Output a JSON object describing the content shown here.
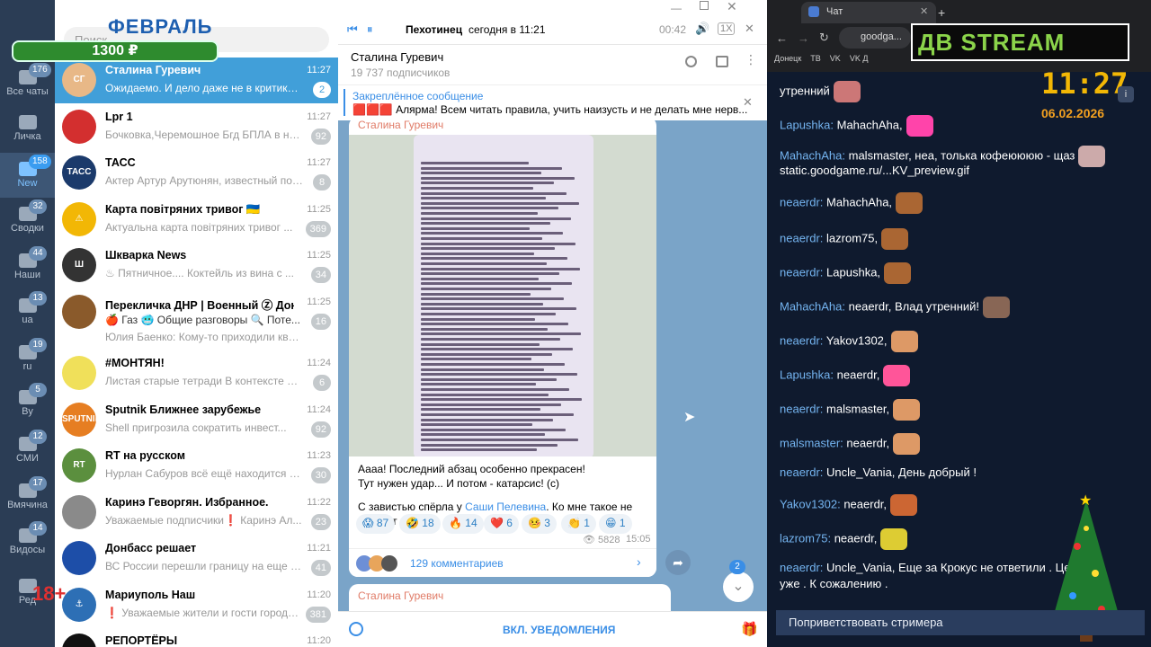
{
  "rail": {
    "items": [
      {
        "label": "Все чаты",
        "count": "176"
      },
      {
        "label": "Личка",
        "count": ""
      },
      {
        "label": "New",
        "count": "158"
      },
      {
        "label": "Сводки",
        "count": "32"
      },
      {
        "label": "Наши",
        "count": "44"
      },
      {
        "label": "ua",
        "count": "13"
      },
      {
        "label": "ru",
        "count": "19"
      },
      {
        "label": "By",
        "count": "5"
      },
      {
        "label": "СМИ",
        "count": "12"
      },
      {
        "label": "Вмячина",
        "count": "17"
      },
      {
        "label": "Видосы",
        "count": "14"
      },
      {
        "label": "Ред",
        "count": ""
      }
    ]
  },
  "promo": {
    "month": "ФЕВРАЛЬ",
    "amount": "1300 ₽",
    "age": "18+"
  },
  "search": {
    "placeholder": "Поиск"
  },
  "chats": [
    {
      "name": "Сталина Гуревич",
      "time": "11:27",
      "preview": "Ожидаемо. И дело даже не в критике С...",
      "badge": "2",
      "avatar": "СГ",
      "color": "#e8b887"
    },
    {
      "name": "Lpr 1",
      "time": "11:27",
      "preview": "Бочковка,Черемошное Бгд БПЛА в нап...",
      "badge": "92",
      "avatar": "",
      "color": "#d32f2f"
    },
    {
      "name": "ТАСС",
      "time": "11:27",
      "preview": "Актер Артур Арутюнян, известный по роли...",
      "badge": "8",
      "avatar": "ТАСС",
      "color": "#1b3a6b"
    },
    {
      "name": "Карта повітряних тривог 🇺🇦",
      "time": "11:25",
      "preview": "Актуальна карта повітряних тривог ...",
      "badge": "369",
      "avatar": "⚠",
      "color": "#f2b705"
    },
    {
      "name": "Шкварка News",
      "time": "11:25",
      "preview": "♨ Пятничное.... Коктейль из вина с ...",
      "badge": "34",
      "avatar": "Ш",
      "color": "#333"
    },
    {
      "name": "Перекличка ДНР | Военный Ⓩ Дон...",
      "time": "11:25",
      "preview": "Юлия Баенко: Кому-то приходили квита...",
      "badge": "16",
      "avatar": "",
      "color": "#8a5a2b"
    },
    {
      "name": "#МОНТЯН!",
      "time": "11:24",
      "preview": "Листая старые тетради  В контексте оч...",
      "badge": "6",
      "avatar": "",
      "color": "#f0e05a"
    },
    {
      "name": "Sputnik Ближнее зарубежье",
      "time": "11:24",
      "preview": "Shell пригрозила сократить инвест...",
      "badge": "92",
      "avatar": "SPUTNIK",
      "color": "#e67e22"
    },
    {
      "name": "RT на русском",
      "time": "11:23",
      "preview": "Нурлан Сабуров всё ещё находится во...",
      "badge": "30",
      "avatar": "RT",
      "color": "#5b8f3e"
    },
    {
      "name": "Каринэ Геворгян. Избранное.",
      "time": "11:22",
      "preview": "Уважаемые подписчики❗ Каринэ Ал...",
      "badge": "23",
      "avatar": "",
      "color": "#8a8a8a"
    },
    {
      "name": "Донбасс решает",
      "time": "11:21",
      "preview": "ВС России перешли границу на еще н...",
      "badge": "41",
      "avatar": "",
      "color": "#1d4ea8"
    },
    {
      "name": "Мариуполь Наш",
      "time": "11:20",
      "preview": "❗ Уважаемые жители и гости города М...",
      "badge": "381",
      "avatar": "⚓",
      "color": "#2d6fb5"
    },
    {
      "name": "РЕПОРТЁРЫ",
      "time": "11:20",
      "preview": "",
      "badge": "",
      "avatar": "",
      "color": "#111"
    }
  ],
  "forum_tabs": "🍎 Газ   🥶 Общие разговоры  🔍 Поте...",
  "player": {
    "title": "Пехотинец",
    "time": "сегодня в 11:21",
    "remaining": "00:42",
    "speed": "1X"
  },
  "channel": {
    "name": "Сталина Гуревич",
    "subs": "19 737 подписчиков"
  },
  "pinned": {
    "label": "Закреплённое сообщение",
    "text": "🟥🟥🟥 Алярма! Всем читать правила, учить наизусть и не делать мне нерв..."
  },
  "post": {
    "author": "Сталина Гуревич",
    "line1": "Аааа! Последний абзац особенно прекрасен!",
    "line2": "Тут нужен удар... И потом - катарсис! (с)",
    "line3a": "С завистью спёрла у ",
    "line3b": "Саши Пелевина",
    "line3c": ". Ко мне такое не заходит",
    "views": "5828",
    "time": "15:05",
    "comments": "129 комментариев",
    "reactions": [
      "😱 87",
      "🤣 18",
      "🔥 14",
      "❤️ 6",
      "🤒 3",
      "👏 1",
      "😁 1"
    ],
    "next_author": "Сталина Гуревич",
    "unread": "2"
  },
  "composer": {
    "label": "ВКЛ. УВЕДОМЛЕНИЯ"
  },
  "browser": {
    "tab": "Чат",
    "url": "goodga...",
    "bookmarks": [
      "Донецк",
      "ТВ",
      "VK",
      "VK Д"
    ]
  },
  "overlay": {
    "logo": "ДВ STREAM",
    "time": "11:27",
    "date": "06.02.2026"
  },
  "stream_chat": [
    {
      "user": "",
      "text": "утренний"
    },
    {
      "user": "Lapushka:",
      "text": "MahachAha,"
    },
    {
      "user": "MahachAha:",
      "text": "malsmaster, неа, толька кофеюююю - щаз"
    },
    {
      "user": "",
      "text": "static.goodgame.ru/...KV_preview.gif"
    },
    {
      "user": "neaerdr:",
      "text": "MahachAha,"
    },
    {
      "user": "neaerdr:",
      "text": "lazrom75,"
    },
    {
      "user": "neaerdr:",
      "text": "Lapushka,"
    },
    {
      "user": "MahachAha:",
      "text": "neaerdr, Влад               утренний!"
    },
    {
      "user": "neaerdr:",
      "text": "Yakov1302,"
    },
    {
      "user": "Lapushka:",
      "text": "neaerdr,"
    },
    {
      "user": "neaerdr:",
      "text": "malsmaster,"
    },
    {
      "user": "malsmaster:",
      "text": "neaerdr,"
    },
    {
      "user": "neaerdr:",
      "text": "Uncle_Vania, День добрый !"
    },
    {
      "user": "Yakov1302:",
      "text": "neaerdr,"
    },
    {
      "user": "lazrom75:",
      "text": "neaerdr,"
    },
    {
      "user": "neaerdr:",
      "text": "Uncle_Vania, Еще за Крокус не ответили . Цел"
    },
    {
      "user": "",
      "text": "уже . К сожалению ."
    }
  ],
  "greet": "Поприветствовать стримера"
}
